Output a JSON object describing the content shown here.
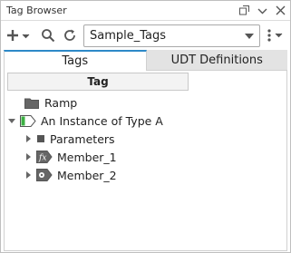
{
  "window": {
    "title": "Tag Browser",
    "buttons": [
      "float-icon",
      "minimize-icon",
      "close-icon"
    ]
  },
  "toolbar": {
    "provider_value": "Sample_Tags"
  },
  "tabs": [
    {
      "label": "Tags",
      "active": true
    },
    {
      "label": "UDT Definitions",
      "active": false
    }
  ],
  "tree": {
    "column_header": "Tag",
    "rows": [
      {
        "label": "Ramp",
        "icon": "folder-icon",
        "expander": "none"
      },
      {
        "label": "An Instance of Type A",
        "icon": "udt-instance-icon",
        "expander": "expanded"
      },
      {
        "label": "Parameters",
        "icon": "parameter-icon",
        "expander": "collapsed"
      },
      {
        "label": "Member_1",
        "icon": "expression-tag-icon",
        "expander": "collapsed"
      },
      {
        "label": "Member_2",
        "icon": "opc-tag-icon",
        "expander": "collapsed"
      }
    ]
  },
  "colors": {
    "accent": "#2d89c8",
    "udt_green": "#3cb043"
  }
}
